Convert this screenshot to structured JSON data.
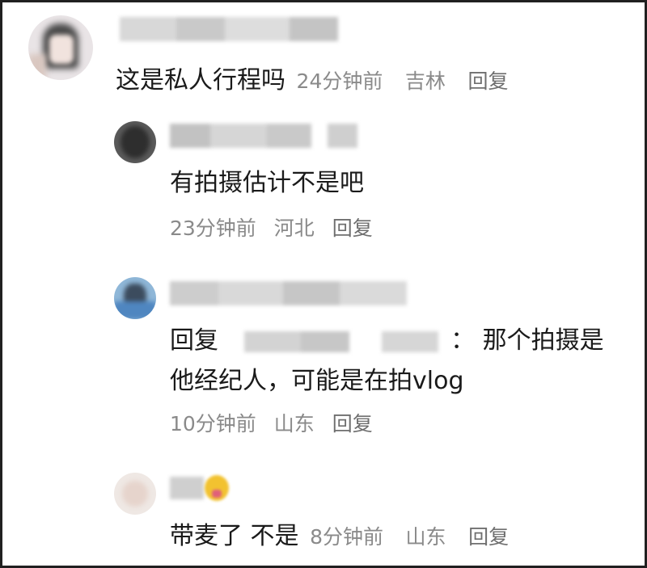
{
  "comments": [
    {
      "text": "这是私人行程吗",
      "time": "24分钟前",
      "location": "吉林",
      "reply_label": "回复"
    },
    {
      "text": "有拍摄估计不是吧",
      "time": "23分钟前",
      "location": "河北",
      "reply_label": "回复"
    },
    {
      "reply_prefix": "回复",
      "separator": "：",
      "text_line1": "那个拍摄是",
      "text_line2": "他经纪人，可能是在拍vlog",
      "time": "10分钟前",
      "location": "山东",
      "reply_label": "回复"
    },
    {
      "text": "带麦了 不是",
      "time": "8分钟前",
      "location": "山东",
      "reply_label": "回复"
    }
  ],
  "colors": {
    "text": "#1a1a1a",
    "meta": "#8a8a8a",
    "blur": "#cfcfcf"
  }
}
